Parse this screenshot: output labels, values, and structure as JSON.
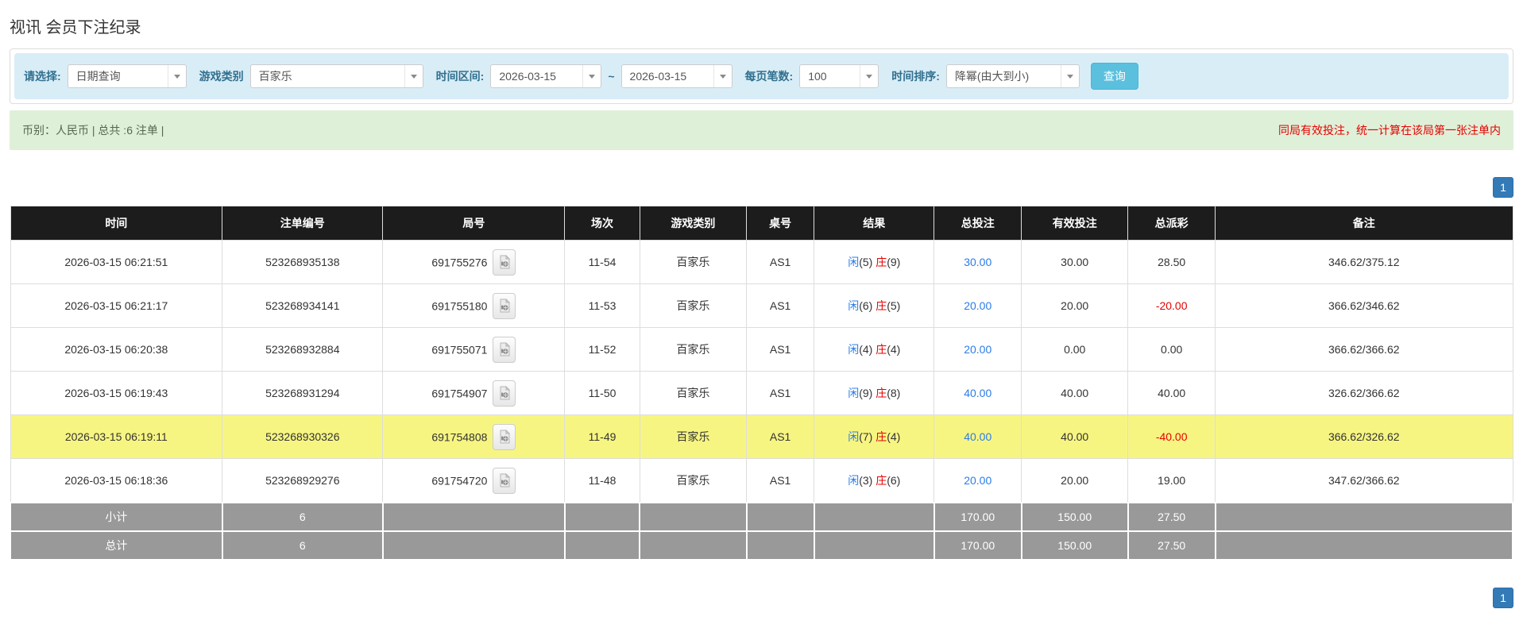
{
  "page": {
    "title": "视讯 会员下注纪录"
  },
  "filters": {
    "select_label": "请选择:",
    "select_value": "日期查询",
    "game_type_label": "游戏类别",
    "game_type_value": "百家乐",
    "time_range_label": "时间区间:",
    "date_from": "2026-03-15",
    "tilde": "~",
    "date_to": "2026-03-15",
    "page_size_label": "每页笔数:",
    "page_size_value": "100",
    "sort_label": "时间排序:",
    "sort_value": "降幂(由大到小)",
    "search_button": "查询"
  },
  "summary": {
    "currency_total": "币别：人民币 | 总共 :6 注单 |",
    "note": "同局有效投注，统一计算在该局第一张注单内"
  },
  "pagination": {
    "page": "1"
  },
  "colors": {
    "filter_bg": "#d9edf7",
    "filter_label": "#31708f",
    "query_button": "#5bc0de",
    "summary_bg": "#dff0d8",
    "note_red": "#e60000",
    "header_black": "#1c1c1c",
    "footer_gray": "#999999",
    "highlight_yellow": "#f7f582",
    "link_blue": "#2a7cea",
    "pager_blue": "#337ab7"
  },
  "table": {
    "headers": [
      "时间",
      "注单编号",
      "局号",
      "场次",
      "游戏类别",
      "桌号",
      "结果",
      "总投注",
      "有效投注",
      "总派彩",
      "备注"
    ],
    "rows": [
      {
        "time": "2026-03-15 06:21:51",
        "bet_no": "523268935138",
        "round_no": "691755276",
        "session": "11-54",
        "game": "百家乐",
        "table_no": "AS1",
        "player": "闲",
        "player_score": "(5)",
        "banker": "庄",
        "banker_score": "(9)",
        "total_bet": "30.00",
        "valid_bet": "30.00",
        "payout": "28.50",
        "note": "346.62/375.12",
        "highlight": false
      },
      {
        "time": "2026-03-15 06:21:17",
        "bet_no": "523268934141",
        "round_no": "691755180",
        "session": "11-53",
        "game": "百家乐",
        "table_no": "AS1",
        "player": "闲",
        "player_score": "(6)",
        "banker": "庄",
        "banker_score": "(5)",
        "total_bet": "20.00",
        "valid_bet": "20.00",
        "payout": "-20.00",
        "note": "366.62/346.62",
        "highlight": false
      },
      {
        "time": "2026-03-15 06:20:38",
        "bet_no": "523268932884",
        "round_no": "691755071",
        "session": "11-52",
        "game": "百家乐",
        "table_no": "AS1",
        "player": "闲",
        "player_score": "(4)",
        "banker": "庄",
        "banker_score": "(4)",
        "total_bet": "20.00",
        "valid_bet": "0.00",
        "payout": "0.00",
        "note": "366.62/366.62",
        "highlight": false
      },
      {
        "time": "2026-03-15 06:19:43",
        "bet_no": "523268931294",
        "round_no": "691754907",
        "session": "11-50",
        "game": "百家乐",
        "table_no": "AS1",
        "player": "闲",
        "player_score": "(9)",
        "banker": "庄",
        "banker_score": "(8)",
        "total_bet": "40.00",
        "valid_bet": "40.00",
        "payout": "40.00",
        "note": "326.62/366.62",
        "highlight": false
      },
      {
        "time": "2026-03-15 06:19:11",
        "bet_no": "523268930326",
        "round_no": "691754808",
        "session": "11-49",
        "game": "百家乐",
        "table_no": "AS1",
        "player": "闲",
        "player_score": "(7)",
        "banker": "庄",
        "banker_score": "(4)",
        "total_bet": "40.00",
        "valid_bet": "40.00",
        "payout": "-40.00",
        "note": "366.62/326.62",
        "highlight": true
      },
      {
        "time": "2026-03-15 06:18:36",
        "bet_no": "523268929276",
        "round_no": "691754720",
        "session": "11-48",
        "game": "百家乐",
        "table_no": "AS1",
        "player": "闲",
        "player_score": "(3)",
        "banker": "庄",
        "banker_score": "(6)",
        "total_bet": "20.00",
        "valid_bet": "20.00",
        "payout": "19.00",
        "note": "347.62/366.62",
        "highlight": false
      }
    ],
    "footer": [
      {
        "label": "小计",
        "count": "6",
        "total_bet": "170.00",
        "valid_bet": "150.00",
        "payout": "27.50"
      },
      {
        "label": "总计",
        "count": "6",
        "total_bet": "170.00",
        "valid_bet": "150.00",
        "payout": "27.50"
      }
    ]
  }
}
